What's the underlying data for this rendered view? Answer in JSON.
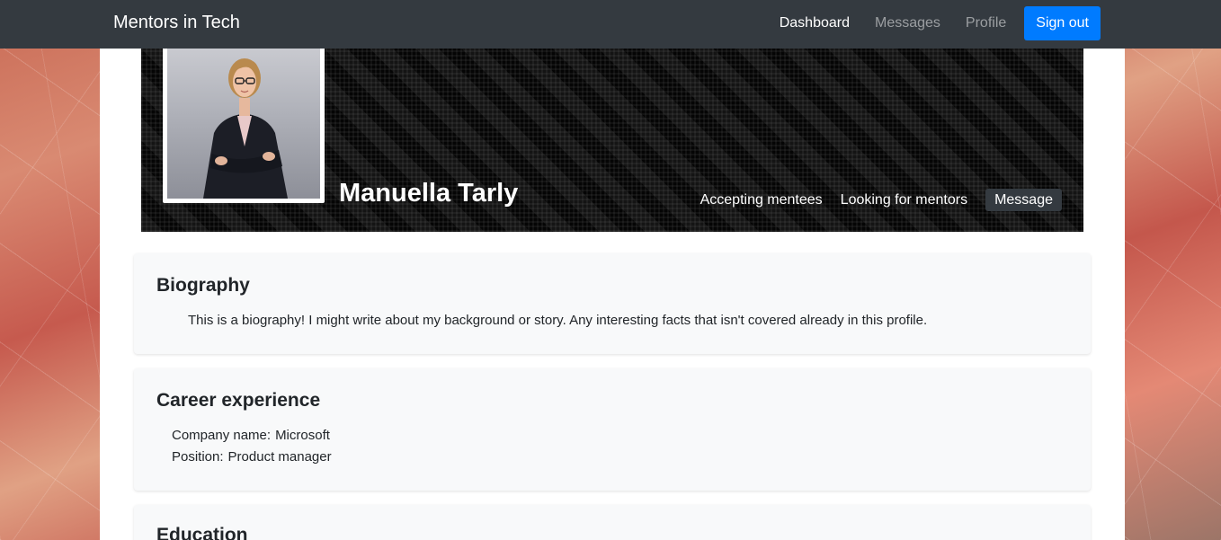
{
  "navbar": {
    "brand": "Mentors in Tech",
    "links": [
      "Dashboard",
      "Messages",
      "Profile"
    ],
    "signout_label": "Sign out"
  },
  "profile": {
    "name": "Manuella Tarly",
    "accepting_mentees": "Accepting mentees",
    "looking_for_mentors": "Looking for mentors",
    "message_label": "Message"
  },
  "biography": {
    "title": "Biography",
    "text": "This is a biography! I might write about my background or story. Any interesting facts that isn't covered already in this profile."
  },
  "career": {
    "title": "Career experience",
    "company_key": "Company name:",
    "company_value": "Microsoft",
    "position_key": "Position:",
    "position_value": "Product manager"
  },
  "education": {
    "title": "Education"
  },
  "colors": {
    "navbar": "#343a40",
    "primary": "#007bff",
    "card": "#f8f9fa"
  }
}
